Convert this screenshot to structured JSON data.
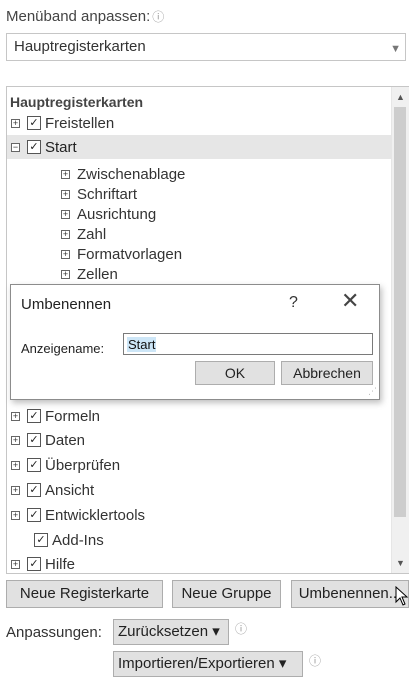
{
  "header": {
    "title": "Menüband anpassen:",
    "info_icon": "info-icon"
  },
  "dropdown": {
    "value": "Hauptregisterkarten"
  },
  "tree": {
    "header": "Hauptregisterkarten",
    "items_top": [
      {
        "label": "Freistellen",
        "expanded": false,
        "checked": true
      },
      {
        "label": "Start",
        "expanded": true,
        "checked": true,
        "selected": true
      }
    ],
    "children": [
      "Zwischenablage",
      "Schriftart",
      "Ausrichtung",
      "Zahl",
      "Formatvorlagen",
      "Zellen"
    ],
    "items_bottom": [
      {
        "label": "Formeln",
        "checked": true
      },
      {
        "label": "Daten",
        "checked": true
      },
      {
        "label": "Überprüfen",
        "checked": true
      },
      {
        "label": "Ansicht",
        "checked": true
      },
      {
        "label": "Entwicklertools",
        "checked": true
      },
      {
        "label": "Add-Ins",
        "checked": true
      },
      {
        "label": "Hilfe",
        "checked": true
      }
    ]
  },
  "dialog": {
    "title": "Umbenennen",
    "help": "?",
    "close": "✕",
    "field_label": "Anzeigename:",
    "field_value": "Start",
    "ok": "OK",
    "cancel": "Abbrechen"
  },
  "buttons": {
    "new_tab": "Neue Registerkarte",
    "new_group": "Neue Gruppe",
    "rename": "Umbenennen..."
  },
  "customizations": {
    "label": "Anpassungen:",
    "reset": "Zurücksetzen ▾",
    "import_export": "Importieren/Exportieren ▾"
  },
  "colors": {
    "selected_row": "#e6e6e6",
    "button_bg": "#e1e1e1",
    "selection_highlight": "#cde6f7"
  }
}
